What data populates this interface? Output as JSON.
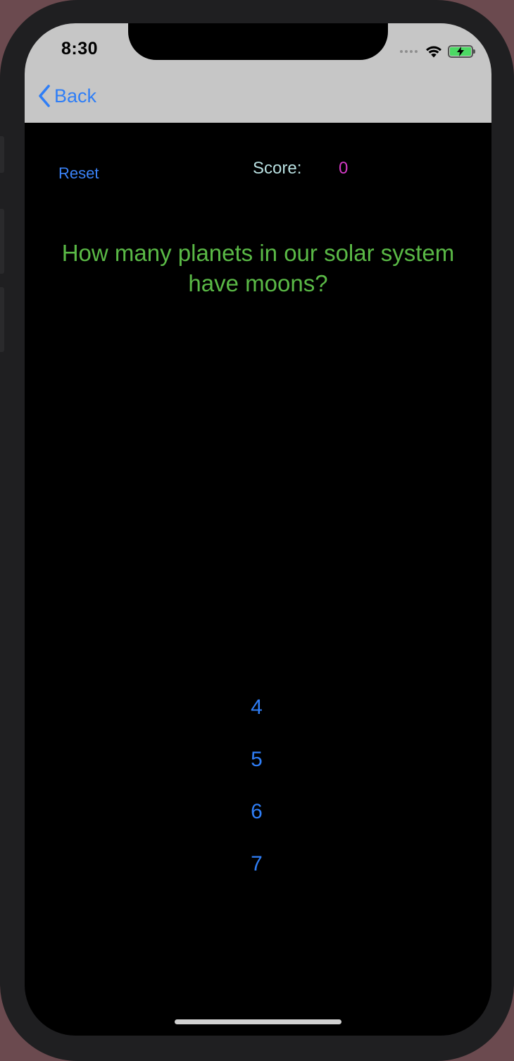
{
  "status_bar": {
    "time": "8:30",
    "icons": [
      "signal-dots-icon",
      "wifi-icon",
      "battery-charging-icon"
    ]
  },
  "nav": {
    "back_label": "Back"
  },
  "toolbar": {
    "reset_label": "Reset",
    "score_label": "Score:",
    "score_value": "0"
  },
  "quiz": {
    "question": "How many planets in our solar system have moons?",
    "answers": [
      "4",
      "5",
      "6",
      "7"
    ]
  },
  "colors": {
    "accent_blue": "#2f7ef6",
    "question_green": "#5ab946",
    "score_magenta": "#d43ac6",
    "score_label": "#b8dfe0",
    "nav_bar": "#c6c6c6"
  }
}
